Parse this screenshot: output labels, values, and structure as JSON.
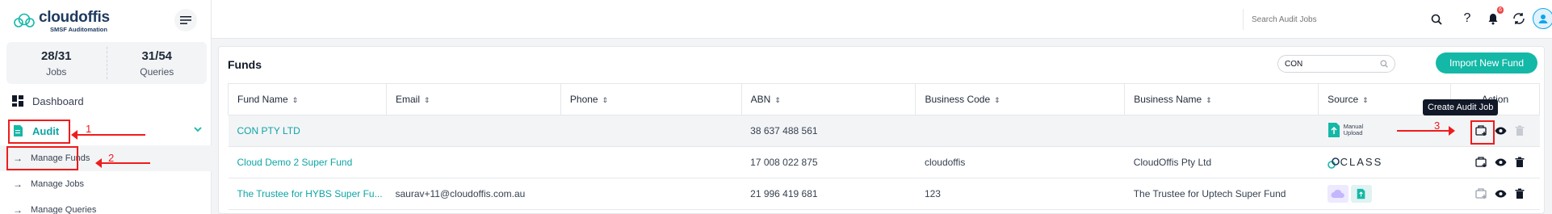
{
  "app": {
    "logo_name": "cloudoffis",
    "logo_tagline": "SMSF Auditomation"
  },
  "sidebar": {
    "stats": [
      {
        "value": "28/31",
        "label": "Jobs"
      },
      {
        "value": "31/54",
        "label": "Queries"
      }
    ],
    "nav": {
      "dashboard": "Dashboard",
      "audit": "Audit",
      "sub_items": [
        "Manage Funds",
        "Manage Jobs",
        "Manage Queries"
      ]
    }
  },
  "topbar": {
    "search_placeholder": "Search Audit Jobs",
    "notification_count": "6"
  },
  "funds": {
    "title": "Funds",
    "filter_value": "CON",
    "import_label": "Import New Fund",
    "columns": [
      "Fund Name",
      "Email",
      "Phone",
      "ABN",
      "Business Code",
      "Business Name",
      "Source",
      "Action"
    ],
    "rows": [
      {
        "fund_name": "CON PTY LTD",
        "email": "",
        "phone": "",
        "abn": "38 637 488 561",
        "business_code": "",
        "business_name": "",
        "source": "Manual Upload"
      },
      {
        "fund_name": "Cloud Demo 2 Super Fund",
        "email": "",
        "phone": "",
        "abn": "17 008 022 875",
        "business_code": "cloudoffis",
        "business_name": "CloudOffis Pty Ltd",
        "source": "CLASS"
      },
      {
        "fund_name": "The Trustee for HYBS Super Fu...",
        "email": "saurav+11@cloudoffis.com.au",
        "phone": "",
        "abn": "21 996 419 681",
        "business_code": "123",
        "business_name": "The Trustee for Uptech Super Fund",
        "source": ""
      }
    ],
    "source_manual_lines": [
      "Manual",
      "Upload"
    ],
    "tooltip": "Create Audit Job"
  },
  "annotations": [
    "1",
    "2",
    "3"
  ],
  "colors": {
    "accent": "#14b8a6",
    "link": "#0ea5a4",
    "annotation": "#ef1c1c"
  }
}
